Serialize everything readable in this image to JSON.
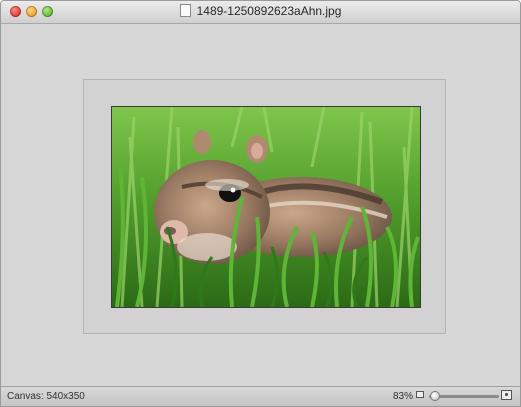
{
  "window": {
    "title": "1489-1250892623aAhn.jpg",
    "buttons": {
      "close": "close-icon",
      "minimize": "minimize-icon",
      "zoom": "zoom-window-icon"
    }
  },
  "statusbar": {
    "canvas_label": "Canvas: 540x350",
    "zoom_label": "83%",
    "zoom_percent": 83,
    "icons": {
      "small": "zoom-out-icon",
      "large": "zoom-in-icon"
    }
  },
  "colors": {
    "window_bg": "#d7d7d7",
    "grass": "#3f8f22",
    "close": "#e0443e",
    "minimize": "#f0a83a",
    "maximize": "#6cbf3c"
  }
}
